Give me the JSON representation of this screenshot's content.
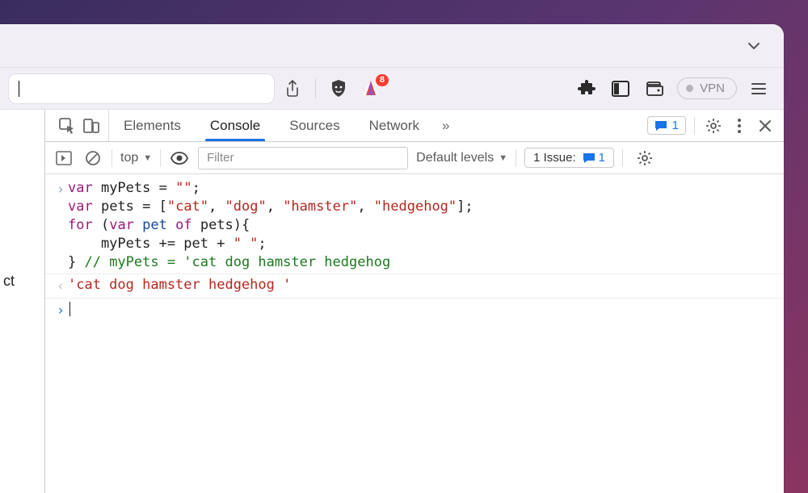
{
  "tabbar": {
    "chevron_icon": "chevron-down"
  },
  "toolbar": {
    "share_icon": "share",
    "shield_icon": "brave-lion",
    "brave_icon": "brave-logo",
    "brave_badge": "8",
    "extensions_icon": "puzzle",
    "sidebar_icon": "panel",
    "wallet_icon": "wallet",
    "vpn_label": "VPN",
    "menu_icon": "hamburger"
  },
  "left_pane": {
    "fragment": "ct"
  },
  "devtools": {
    "tabs": [
      "Elements",
      "Console",
      "Sources",
      "Network"
    ],
    "active_tab": "Console",
    "more_label": "»",
    "messages_count": "1",
    "settings_icon": "gear",
    "kebab_icon": "dots-vertical",
    "close_icon": "close"
  },
  "console_toolbar": {
    "run_icon": "play-bracket",
    "clear_icon": "no-sign",
    "context_label": "top",
    "context_caret": "▼",
    "eye_icon": "eye",
    "filter_placeholder": "Filter",
    "levels_label": "Default levels",
    "levels_caret": "▼",
    "issues_label_prefix": "1 Issue:",
    "issues_count": "1",
    "settings_icon": "gear"
  },
  "console": {
    "entry": {
      "l1_a": "var",
      "l1_b": " myPets = ",
      "l1_c": "\"\"",
      "l1_d": ";",
      "l2_a": "var",
      "l2_b": " pets = [",
      "l2_c1": "\"cat\"",
      "l2_s": ", ",
      "l2_c2": "\"dog\"",
      "l2_c3": "\"hamster\"",
      "l2_c4": "\"hedgehog\"",
      "l2_d": "];",
      "l3_a": "for",
      "l3_b": " (",
      "l3_c": "var",
      "l3_d": " pet ",
      "l3_e": "of",
      "l3_f": " pets){",
      "l4_a": "    myPets += pet + ",
      "l4_b": "\" \"",
      "l4_c": ";",
      "l5_a": "} ",
      "l5_b": "// myPets = 'cat dog hamster hedgehog"
    },
    "result": "'cat dog hamster hedgehog '"
  }
}
